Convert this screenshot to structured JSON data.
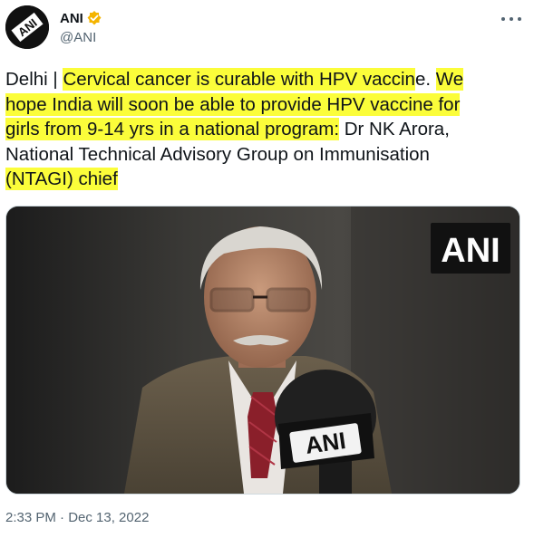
{
  "author": {
    "display_name": "ANI",
    "handle": "@ANI",
    "avatar_icon": "ani-logo-avatar",
    "verified_icon": "verified-badge-icon",
    "verified_color": "#f4b400"
  },
  "more_icon": "more-options-icon",
  "tweet": {
    "line1_a": "Delhi | ",
    "line1_hl": "Cervical cancer is curable with HPV vaccin",
    "line1_b": "e. ",
    "line1_hl2": "We",
    "line2_hl": "hope India will soon be able to provide HPV vaccine for",
    "line3_hl": "girls from 9-14 yrs in a national program:",
    "line3_b": " Dr NK Arora,",
    "line4": "National Technical Advisory Group on Immunisation",
    "line5_hl": "(NTAGI) chief",
    "highlight_color": "#fbfd3a"
  },
  "media": {
    "watermark": "ANI",
    "mic_label": "ANI"
  },
  "timestamp": "2:33 PM · Dec 13, 2022"
}
